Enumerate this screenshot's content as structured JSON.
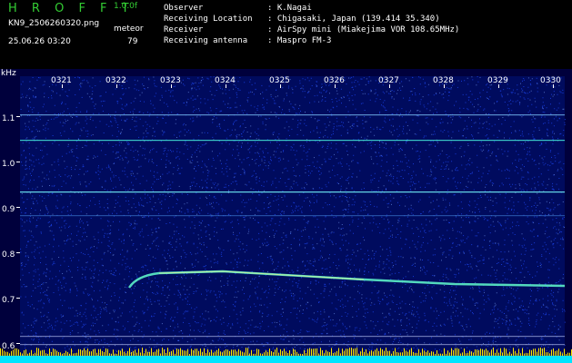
{
  "header": {
    "app_title": "H R O F F T",
    "version": "1.0.0f",
    "filename": "KN9_2506260320.png",
    "meteor_label": "meteor",
    "meteor_value": "79",
    "datetime": "25.06.26 03:20",
    "info": [
      {
        "key": "Observer",
        "value": ": K.Nagai"
      },
      {
        "key": "Receiving Location",
        "value": ": Chigasaki, Japan (139.414 35.340)"
      },
      {
        "key": "Receiver",
        "value": ": AirSpy mini (Miakejima VOR 108.65MHz)"
      },
      {
        "key": "Receiving antenna",
        "value": ": Maspro FM-3"
      }
    ]
  },
  "plot": {
    "y_unit": "kHz",
    "y_ticks": [
      "1.1",
      "1.0",
      "0.9",
      "0.8",
      "0.7",
      "0.6"
    ],
    "x_ticks": [
      "0321",
      "0322",
      "0323",
      "0324",
      "0325",
      "0326",
      "0327",
      "0328",
      "0329",
      "0330"
    ],
    "colors": {
      "background": "#00003c",
      "noise": "#1f4cff",
      "signal": "#5cf0c8",
      "baseline": "#00e5ff"
    }
  }
}
